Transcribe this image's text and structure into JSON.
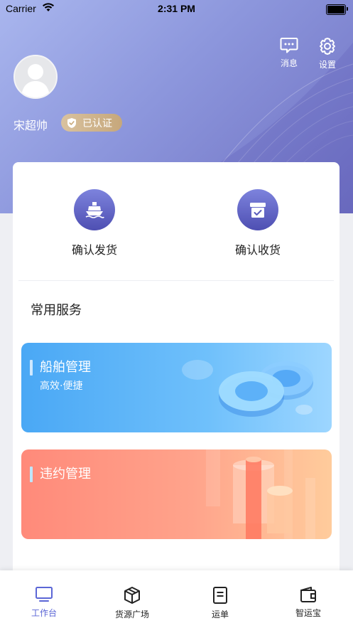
{
  "status_bar": {
    "carrier": "Carrier",
    "time": "2:31 PM"
  },
  "header": {
    "messages_label": "消息",
    "settings_label": "设置",
    "user_name": "宋超帅",
    "verified_label": "已认证"
  },
  "actions": [
    {
      "label": "确认发货",
      "icon": "ship-icon"
    },
    {
      "label": "确认收货",
      "icon": "box-check-icon"
    }
  ],
  "services": {
    "title": "常用服务",
    "items": [
      {
        "title": "船舶管理",
        "subtitle": "高效·便捷"
      },
      {
        "title": "违约管理"
      }
    ]
  },
  "tabbar": {
    "items": [
      {
        "label": "工作台",
        "icon": "monitor-icon",
        "active": true
      },
      {
        "label": "货源广场",
        "icon": "package-icon",
        "active": false
      },
      {
        "label": "运单",
        "icon": "document-icon",
        "active": false
      },
      {
        "label": "智运宝",
        "icon": "wallet-icon",
        "active": false
      }
    ]
  },
  "colors": {
    "accent": "#5b66d6",
    "badge": "#d3b78f",
    "ship_card": "#5fb6f8",
    "breach_card": "#ff9a82"
  }
}
